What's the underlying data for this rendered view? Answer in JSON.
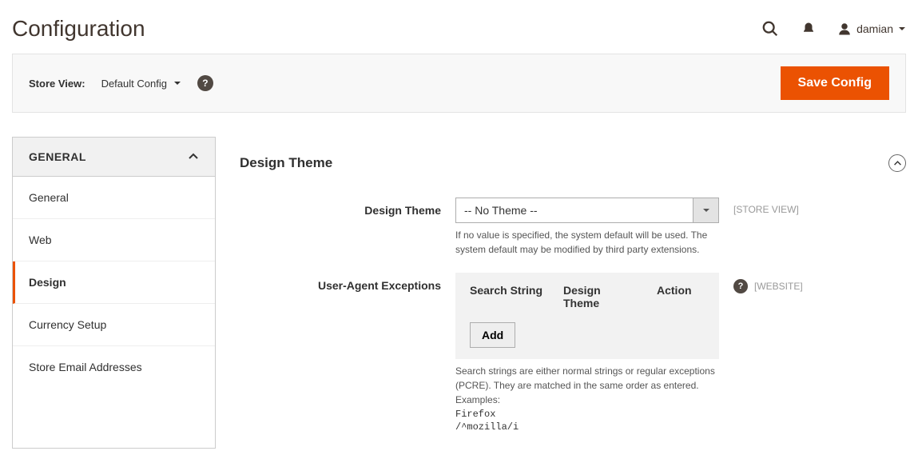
{
  "page": {
    "title": "Configuration"
  },
  "user": {
    "name": "damian"
  },
  "toolbar": {
    "store_view_label": "Store View:",
    "store_view_value": "Default Config",
    "save_label": "Save Config"
  },
  "sidebar": {
    "group_title": "GENERAL",
    "items": [
      {
        "label": "General"
      },
      {
        "label": "Web"
      },
      {
        "label": "Design"
      },
      {
        "label": "Currency Setup"
      },
      {
        "label": "Store Email Addresses"
      }
    ]
  },
  "section": {
    "title": "Design Theme"
  },
  "fields": {
    "design_theme": {
      "label": "Design Theme",
      "value": "-- No Theme --",
      "scope": "[STORE VIEW]",
      "help": "If no value is specified, the system default will be used. The system default may be modified by third party extensions."
    },
    "ua_exceptions": {
      "label": "User-Agent Exceptions",
      "scope": "[WEBSITE]",
      "col_search": "Search String",
      "col_theme": "Design Theme",
      "col_action": "Action",
      "add_label": "Add",
      "help_line1": "Search strings are either normal strings or regular exceptions (PCRE). They are matched in the same order as entered. Examples:",
      "help_ex1": "Firefox",
      "help_ex2": "/^mozilla/i"
    }
  }
}
